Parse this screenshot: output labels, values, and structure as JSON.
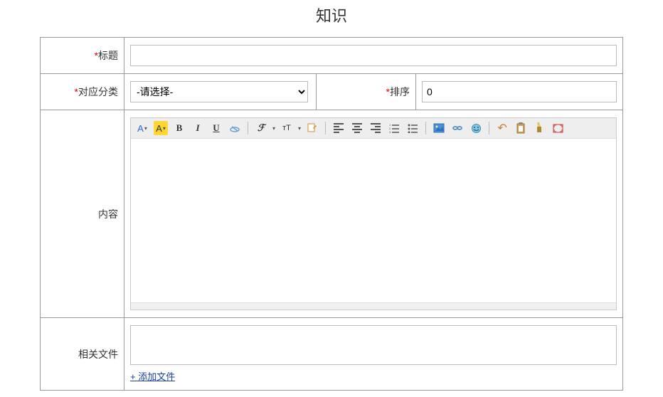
{
  "page": {
    "title": "知识"
  },
  "form": {
    "title": {
      "label": "标题",
      "required": true,
      "value": ""
    },
    "category": {
      "label": "对应分类",
      "required": true,
      "selected": "-请选择-"
    },
    "sort": {
      "label": "排序",
      "required": true,
      "value": "0"
    },
    "content": {
      "label": "内容"
    },
    "files": {
      "label": "相关文件",
      "add_link": "+ 添加文件"
    }
  },
  "editor": {
    "icons": {
      "forecolor": "A",
      "hilite": "A",
      "bold": "B",
      "italic": "I",
      "underline": "U",
      "removeformat": "⌀",
      "fontfamily": "ℱ",
      "fontsize": "тT",
      "formatblock": "✎",
      "alignleft": "align-left",
      "aligncenter": "align-center",
      "alignright": "align-right",
      "ol": "≡",
      "ul": "⋮≡",
      "image": "🖼",
      "link": "🔗",
      "emotion": "😊",
      "undo": "↶",
      "redo": "↷",
      "paste": "📋",
      "fullscreen": "⛶"
    }
  }
}
